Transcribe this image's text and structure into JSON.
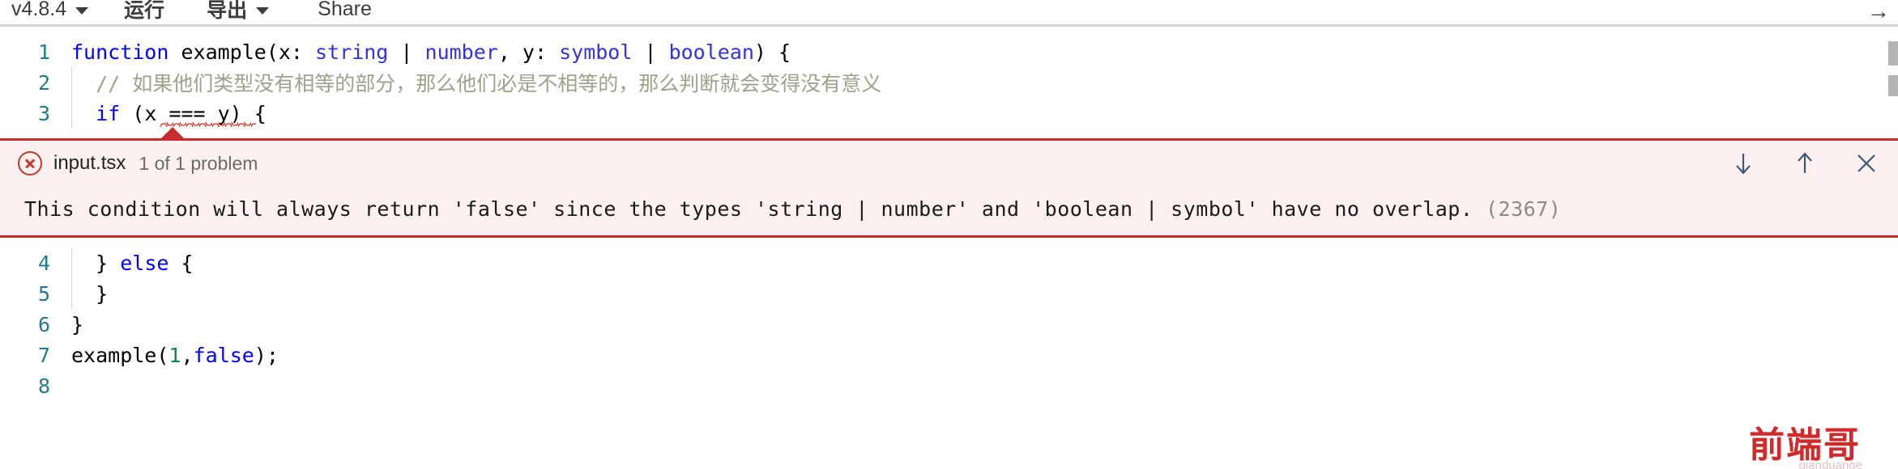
{
  "toolbar": {
    "version_label": "v4.8.4",
    "run_label": "运行",
    "export_label": "导出",
    "share_label": "Share",
    "overflow_label": "→"
  },
  "editor": {
    "filename": "input.tsx",
    "lines": [
      {
        "number": "1",
        "segments": [
          {
            "text": "function ",
            "style": "kw"
          },
          {
            "text": "example",
            "style": "plain"
          },
          {
            "text": "(x: ",
            "style": "plain"
          },
          {
            "text": "string",
            "style": "blue"
          },
          {
            "text": " | ",
            "style": "plain"
          },
          {
            "text": "number",
            "style": "blue"
          },
          {
            "text": ", y: ",
            "style": "plain"
          },
          {
            "text": "symbol",
            "style": "blue"
          },
          {
            "text": " | ",
            "style": "plain"
          },
          {
            "text": "boolean",
            "style": "blue"
          },
          {
            "text": ") {",
            "style": "plain"
          }
        ]
      },
      {
        "number": "2",
        "segments": [
          {
            "text": "  // 如果他们类型没有相等的部分，那么他们必是不相等的，那么判断就会变得没有意义",
            "style": "comment"
          }
        ]
      },
      {
        "number": "3",
        "segments": [
          {
            "text": "  ",
            "style": "plain"
          },
          {
            "text": "if",
            "style": "kw"
          },
          {
            "text": " (x === y) {",
            "style": "plain"
          }
        ]
      },
      {
        "number": "4",
        "segments": [
          {
            "text": "  } ",
            "style": "plain"
          },
          {
            "text": "else",
            "style": "kw"
          },
          {
            "text": " {",
            "style": "plain"
          }
        ]
      },
      {
        "number": "5",
        "segments": [
          {
            "text": "  }",
            "style": "plain"
          }
        ]
      },
      {
        "number": "6",
        "segments": [
          {
            "text": "}",
            "style": "plain"
          }
        ]
      },
      {
        "number": "7",
        "segments": [
          {
            "text": "example(",
            "style": "plain"
          },
          {
            "text": "1",
            "style": "num"
          },
          {
            "text": ",",
            "style": "plain"
          },
          {
            "text": "false",
            "style": "kw"
          },
          {
            "text": ");",
            "style": "plain"
          }
        ]
      },
      {
        "number": "8",
        "segments": []
      }
    ]
  },
  "error_panel": {
    "filename": "input.tsx",
    "problem_count": "1 of 1 problem",
    "message": "This condition will always return 'false' since the types 'string | number' and 'boolean | symbol' have no overlap.",
    "code": "(2367)",
    "next_icon": "arrow-down-icon",
    "prev_icon": "arrow-up-icon",
    "close_icon": "close-icon",
    "accent_color": "#c82d2d",
    "background_color": "#fdf0f0"
  },
  "watermark": {
    "text": "前端哥",
    "sub": "qianduange"
  }
}
